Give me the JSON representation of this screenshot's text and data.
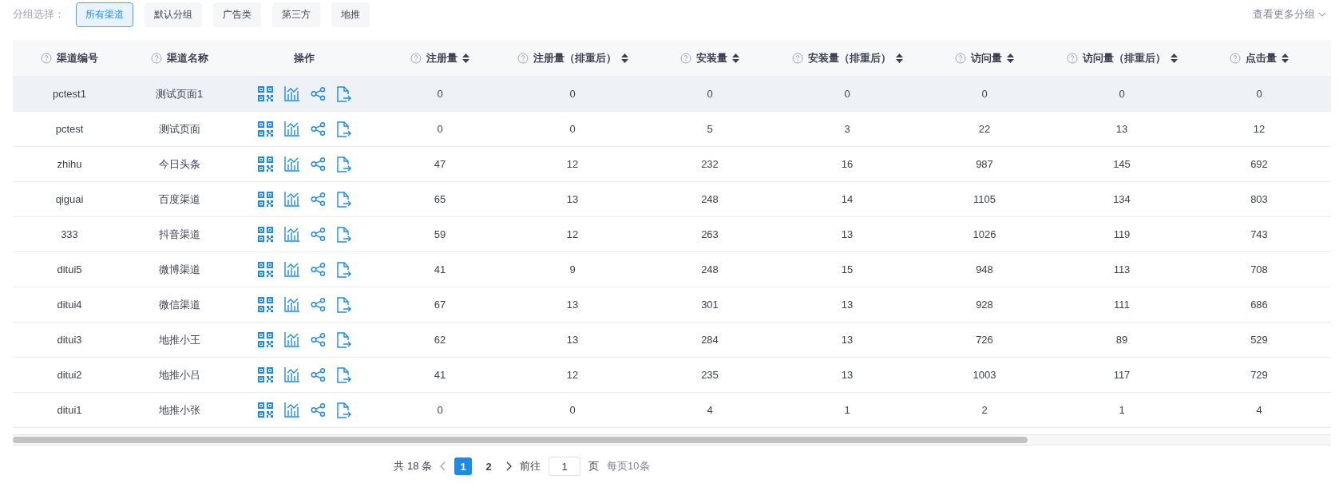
{
  "group_filter": {
    "label": "分组选择：",
    "options": [
      {
        "label": "所有渠道",
        "selected": true
      },
      {
        "label": "默认分组",
        "selected": false
      },
      {
        "label": "广告类",
        "selected": false
      },
      {
        "label": "第三方",
        "selected": false
      },
      {
        "label": "地推",
        "selected": false
      }
    ],
    "more": "查看更多分组"
  },
  "table": {
    "columns": [
      {
        "label": "渠道编号",
        "kind": "help"
      },
      {
        "label": "渠道名称",
        "kind": "help"
      },
      {
        "label": "操作",
        "kind": "actions"
      },
      {
        "label": "注册量",
        "kind": "sortable"
      },
      {
        "label": "注册量（排重后）",
        "kind": "sortable"
      },
      {
        "label": "安装量",
        "kind": "sortable"
      },
      {
        "label": "安装量（排重后）",
        "kind": "sortable"
      },
      {
        "label": "访问量",
        "kind": "sortable"
      },
      {
        "label": "访问量（排重后）",
        "kind": "sortable"
      },
      {
        "label": "点击量",
        "kind": "sortable"
      }
    ],
    "rows": [
      {
        "hovered": true,
        "code": "pctest1",
        "name": "测试页面1",
        "values": [
          "0",
          "0",
          "0",
          "0",
          "0",
          "0",
          "0"
        ]
      },
      {
        "hovered": false,
        "code": "pctest",
        "name": "测试页面",
        "values": [
          "0",
          "0",
          "5",
          "3",
          "22",
          "13",
          "12"
        ]
      },
      {
        "hovered": false,
        "code": "zhihu",
        "name": "今日头条",
        "values": [
          "47",
          "12",
          "232",
          "16",
          "987",
          "145",
          "692"
        ]
      },
      {
        "hovered": false,
        "code": "qiguai",
        "name": "百度渠道",
        "values": [
          "65",
          "13",
          "248",
          "14",
          "1105",
          "134",
          "803"
        ]
      },
      {
        "hovered": false,
        "code": "333",
        "name": "抖音渠道",
        "values": [
          "59",
          "12",
          "263",
          "13",
          "1026",
          "119",
          "743"
        ]
      },
      {
        "hovered": false,
        "code": "ditui5",
        "name": "微博渠道",
        "values": [
          "41",
          "9",
          "248",
          "15",
          "948",
          "113",
          "708"
        ]
      },
      {
        "hovered": false,
        "code": "ditui4",
        "name": "微信渠道",
        "values": [
          "67",
          "13",
          "301",
          "13",
          "928",
          "111",
          "686"
        ]
      },
      {
        "hovered": false,
        "code": "ditui3",
        "name": "地推小王",
        "values": [
          "62",
          "13",
          "284",
          "13",
          "726",
          "89",
          "529"
        ]
      },
      {
        "hovered": false,
        "code": "ditui2",
        "name": "地推小吕",
        "values": [
          "41",
          "12",
          "235",
          "13",
          "1003",
          "117",
          "729"
        ]
      },
      {
        "hovered": false,
        "code": "ditui1",
        "name": "地推小张",
        "values": [
          "0",
          "0",
          "4",
          "1",
          "2",
          "1",
          "4"
        ]
      }
    ]
  },
  "pagination": {
    "total": "共 18 条",
    "pages": [
      {
        "label": "1",
        "selected": true
      },
      {
        "label": "2",
        "selected": false
      }
    ],
    "goto_label": "前往",
    "goto_value": "1",
    "page_unit": "页",
    "page_size": "每页10条"
  }
}
